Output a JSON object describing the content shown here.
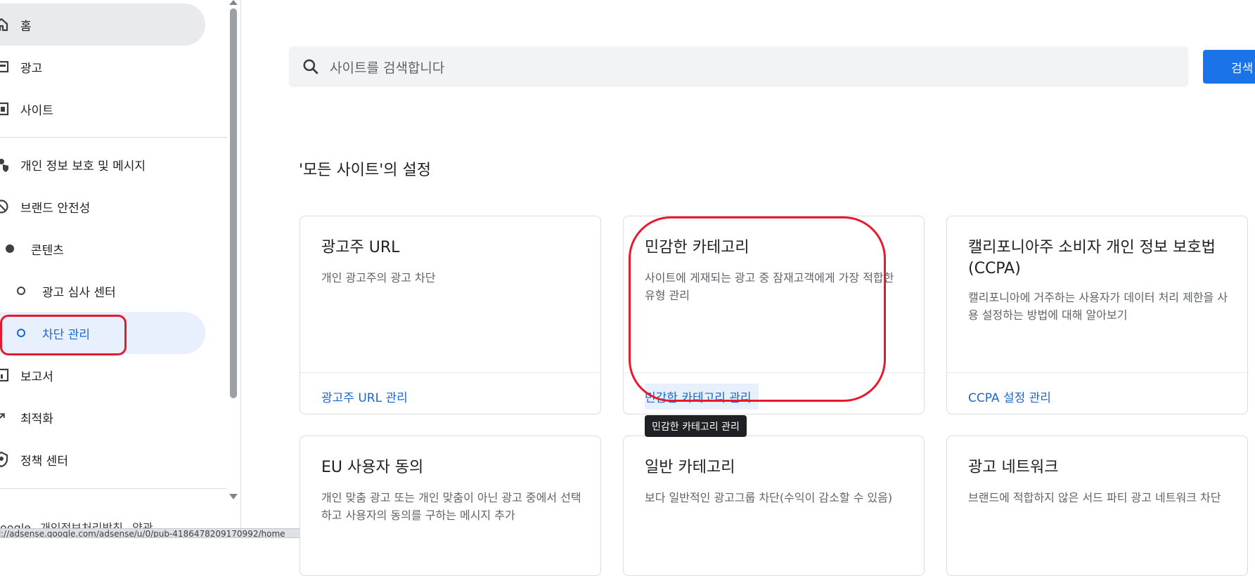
{
  "sidebar": {
    "items": [
      {
        "label": "홈",
        "icon": "home-icon"
      },
      {
        "label": "광고",
        "icon": "ads-icon"
      },
      {
        "label": "사이트",
        "icon": "sites-icon"
      },
      {
        "label": "개인 정보 보호 및 메시지",
        "icon": "privacy-icon"
      },
      {
        "label": "브랜드 안전성",
        "icon": "brand-safety-icon"
      },
      {
        "label": "콘텐츠",
        "icon": "dot-icon"
      },
      {
        "label": "광고 심사 센터",
        "icon": "ring-icon"
      },
      {
        "label": "차단 관리",
        "icon": "ring-icon"
      },
      {
        "label": "보고서",
        "icon": "reports-icon"
      },
      {
        "label": "최적화",
        "icon": "optimize-icon"
      },
      {
        "label": "정책 센터",
        "icon": "policy-icon"
      }
    ],
    "footer": [
      "oogle",
      "개인정보처리방침",
      "약관"
    ],
    "status_url": "://adsense.google.com/adsense/u/0/pub-4186478209170992/home"
  },
  "search": {
    "placeholder": "사이트를 검색합니다",
    "button_label": "검색"
  },
  "main": {
    "section_title": "'모든 사이트'의 설정",
    "cards": [
      {
        "title": "광고주 URL",
        "description": "개인 광고주의 광고 차단",
        "link": "광고주 URL 관리"
      },
      {
        "title": "민감한 카테고리",
        "description": "사이트에 게재되는 광고 중 잠재고객에게 가장 적합한 유형 관리",
        "link": "민감한 카테고리 관리"
      },
      {
        "title": "캘리포니아주 소비자 개인 정보 보호법(CCPA)",
        "description": "캘리포니아에 거주하는 사용자가 데이터 처리 제한을 사용 설정하는 방법에 대해 알아보기",
        "link": "CCPA 설정 관리"
      },
      {
        "title": "EU 사용자 동의",
        "description": "개인 맞춤 광고 또는 개인 맞춤이 아닌 광고 중에서 선택하고 사용자의 동의를 구하는 메시지 추가",
        "link": ""
      },
      {
        "title": "일반 카테고리",
        "description": "보다 일반적인 광고그룹 차단(수익이 감소할 수 있음)",
        "link": ""
      },
      {
        "title": "광고 네트워크",
        "description": "브랜드에 적합하지 않은 서드 파티 광고 네트워크 차단",
        "link": ""
      }
    ],
    "tooltip": "민감한 카테고리 관리"
  },
  "colors": {
    "accent": "#1a73e8",
    "link": "#1967d2",
    "annotation": "#e8192c"
  }
}
